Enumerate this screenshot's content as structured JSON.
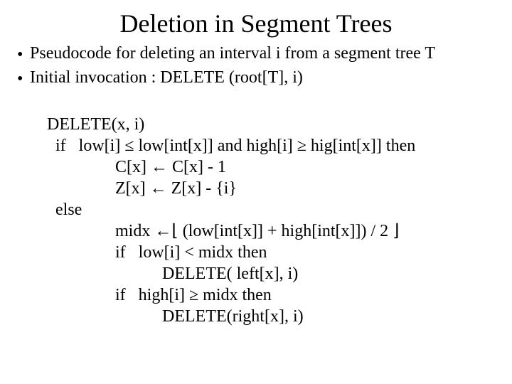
{
  "title": "Deletion in Segment Trees",
  "bullets": [
    "Pseudocode for deleting an interval i from a segment tree T",
    "Initial invocation : DELETE (root[T], i)"
  ],
  "pseudocode": {
    "l1": "DELETE(x, i)",
    "l2": "  if   low[i] ≤ low[int[x]] and high[i] ≥ hig[int[x]] then",
    "l3": "                C[x] ← C[x] - 1",
    "l4": "                Z[x] ← Z[x] - {i}",
    "l5": "  else",
    "l6": "                midx ←⌊ (low[int[x]] + high[int[x]]) / 2 ⌋",
    "l7": "                if   low[i] < midx then",
    "l8": "                           DELETE( left[x], i)",
    "l9": "                if   high[i] ≥ midx then",
    "l10": "                           DELETE(right[x], i)"
  }
}
